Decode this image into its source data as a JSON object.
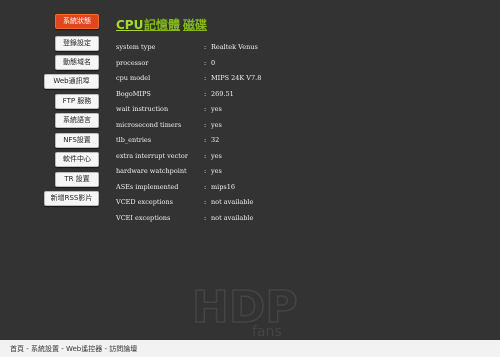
{
  "sidebar": {
    "items": [
      {
        "label": "系統狀態",
        "active": true
      },
      {
        "label": "登錄設定",
        "active": false
      },
      {
        "label": "動態域名",
        "active": false
      },
      {
        "label": "Web通訊埠",
        "active": false
      },
      {
        "label": "FTP 服務",
        "active": false
      },
      {
        "label": "系統語言",
        "active": false
      },
      {
        "label": "NFS設置",
        "active": false
      },
      {
        "label": "軟件中心",
        "active": false
      },
      {
        "label": "TR 設置",
        "active": false
      },
      {
        "label": "新增RSS影片",
        "active": false
      }
    ]
  },
  "tabs": [
    {
      "label": "CPU",
      "active": true
    },
    {
      "label": "記憶體",
      "active": false
    },
    {
      "label": "磁碟",
      "active": false
    }
  ],
  "cpu_info": [
    {
      "key": "system type",
      "sep": ":",
      "value": "Realtek Venus"
    },
    {
      "key": "processor",
      "sep": ":",
      "value": "0"
    },
    {
      "key": "cpu model",
      "sep": ":",
      "value": "MIPS 24K V7.8"
    },
    {
      "key": "BogoMIPS",
      "sep": ":",
      "value": "269.51"
    },
    {
      "key": "wait instruction",
      "sep": ":",
      "value": "yes"
    },
    {
      "key": "microsecond timers",
      "sep": ":",
      "value": "yes"
    },
    {
      "key": "tlb_entries",
      "sep": ":",
      "value": "32"
    },
    {
      "key": "extra interrupt vector",
      "sep": ":",
      "value": "yes"
    },
    {
      "key": "hardware watchpoint",
      "sep": ":",
      "value": "yes"
    },
    {
      "key": "ASEs implemented",
      "sep": ":",
      "value": "mips16"
    },
    {
      "key": "VCED exceptions",
      "sep": ":",
      "value": "not available"
    },
    {
      "key": "VCEI exceptions",
      "sep": ":",
      "value": "not available"
    }
  ],
  "watermark": {
    "logo": "HDP",
    "sub": "fans"
  },
  "footer": {
    "breadcrumb": "首頁 - 系統設置 - Web遙控器 - 訪問論壇"
  },
  "colors": {
    "panel_bg": "#333333",
    "active_button": "#e1471c",
    "tab_active": "#a2dc2a",
    "tab": "#84b81c"
  }
}
